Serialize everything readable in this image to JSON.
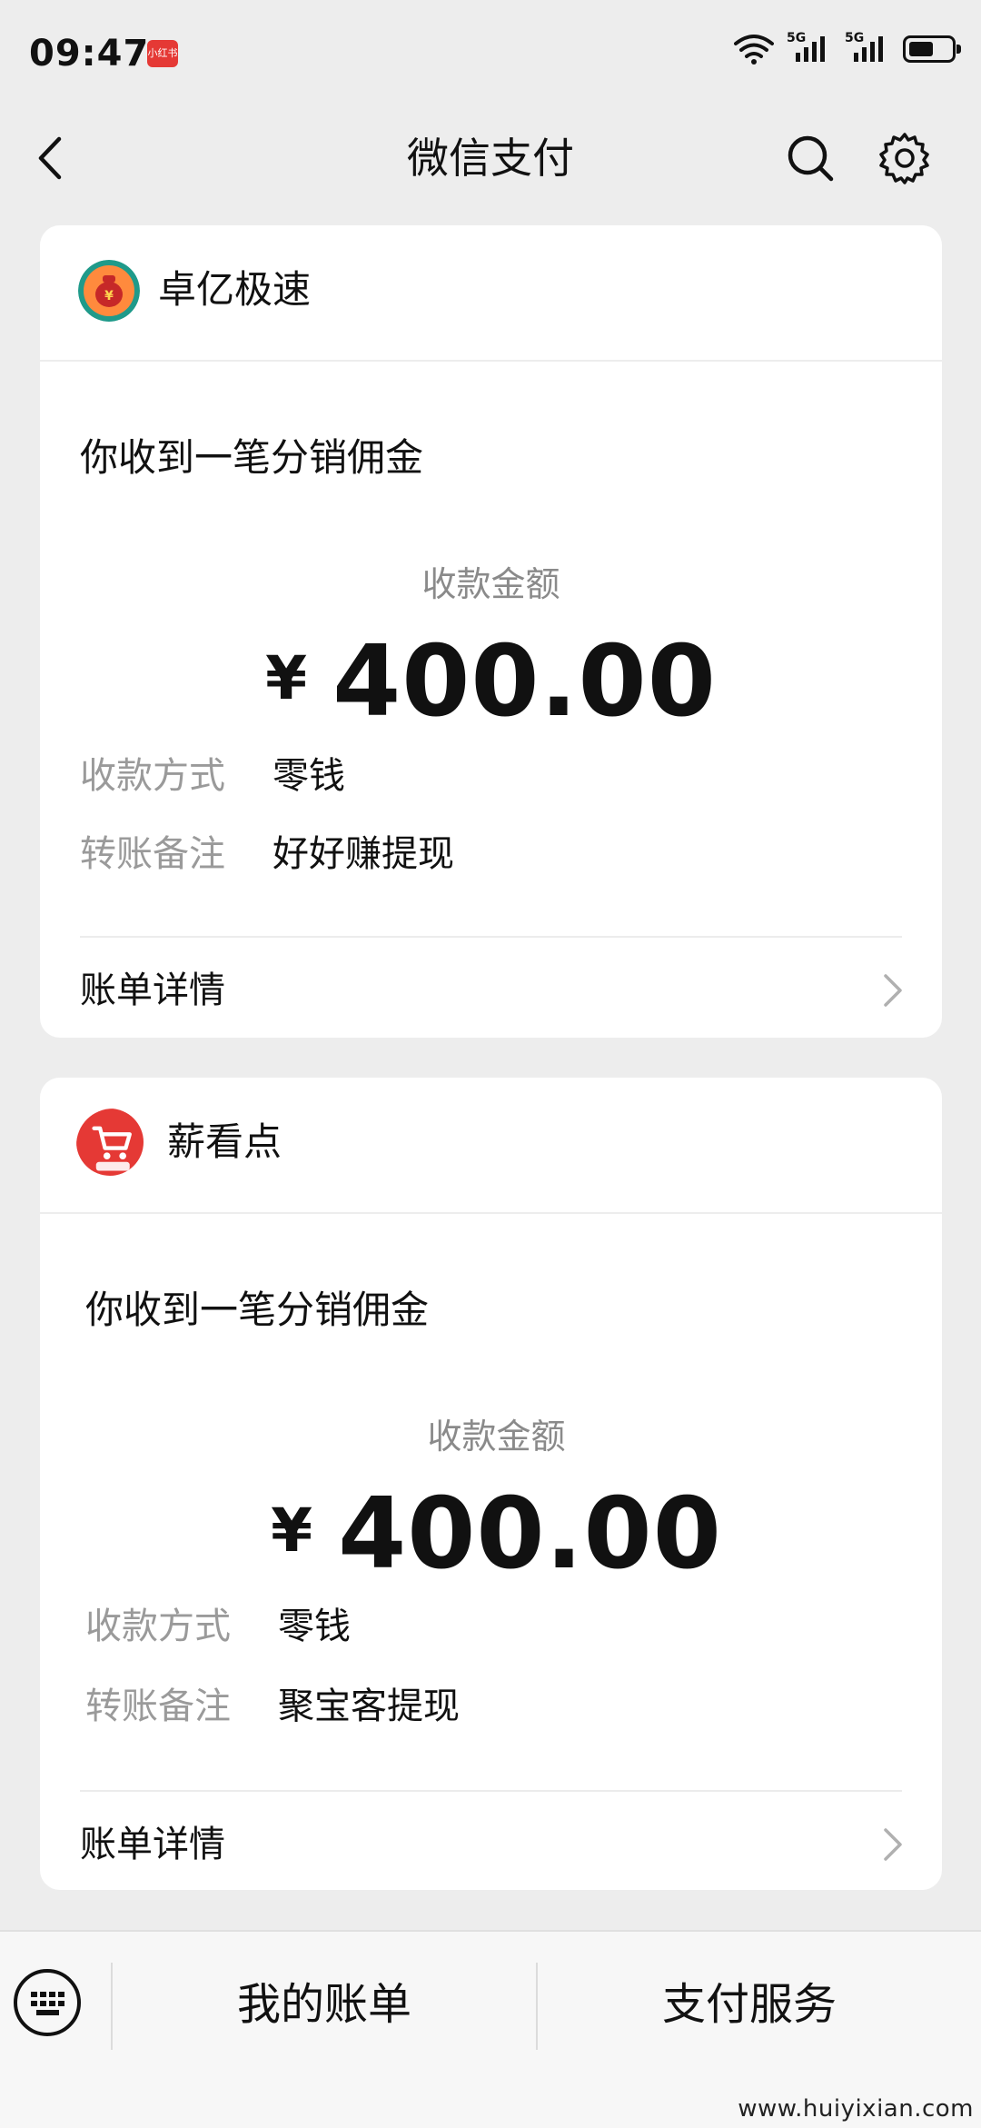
{
  "status_bar": {
    "time": "09:47",
    "app_badge_text": "小红书",
    "network_labels": [
      "5G",
      "5G"
    ]
  },
  "nav": {
    "title": "微信支付"
  },
  "cards": [
    {
      "merchant_name": "卓亿极速",
      "title": "你收到一笔分销佣金",
      "amount_label": "收款金额",
      "currency": "¥",
      "amount": "400.00",
      "rows": [
        {
          "label": "收款方式",
          "value": "零钱"
        },
        {
          "label": "转账备注",
          "value": "好好赚提现"
        }
      ],
      "detail_label": "账单详情"
    },
    {
      "merchant_name": "薪看点",
      "title": "你收到一笔分销佣金",
      "amount_label": "收款金额",
      "currency": "¥",
      "amount": "400.00",
      "rows": [
        {
          "label": "收款方式",
          "value": "零钱"
        },
        {
          "label": "转账备注",
          "value": "聚宝客提现"
        }
      ],
      "detail_label": "账单详情"
    }
  ],
  "bottom_bar": {
    "my_bills": "我的账单",
    "pay_services": "支付服务"
  },
  "watermark": "www.huiyixian.com",
  "icons": {
    "back": "chevron-left-icon",
    "search": "search-icon",
    "settings": "gear-icon",
    "keyboard": "keyboard-icon",
    "detail_arrow": "chevron-right-icon"
  },
  "colors": {
    "background": "#ededed",
    "card": "#ffffff",
    "muted_text": "#8a8a8a",
    "badge_red": "#e53935"
  }
}
